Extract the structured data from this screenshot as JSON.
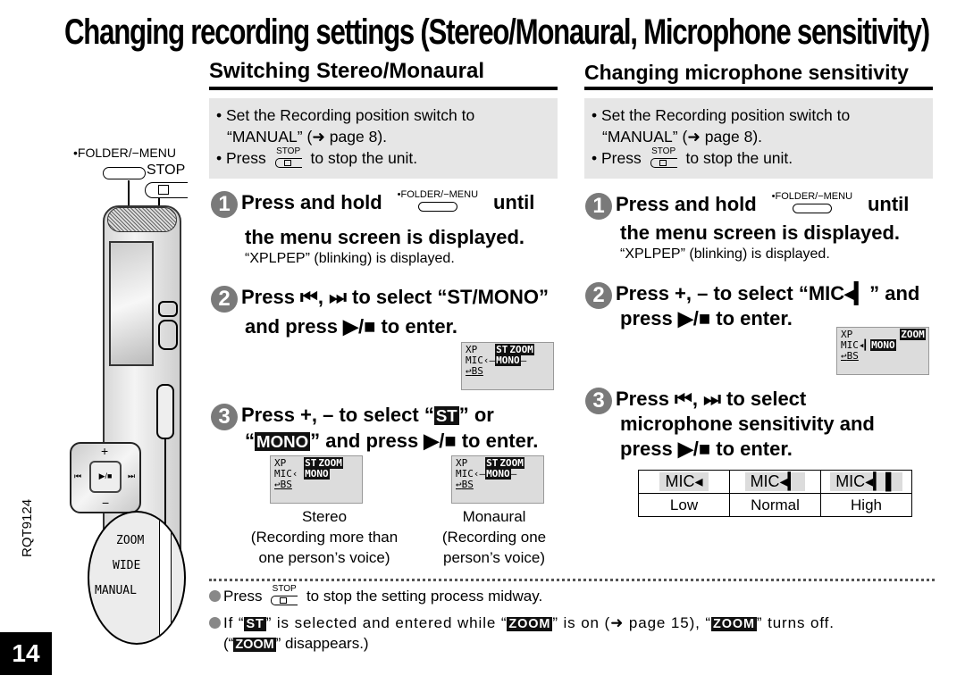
{
  "page": {
    "title": "Changing recording settings (Stereo/Monaural, Microphone sensitivity)",
    "page_number": "14",
    "doc_code": "RQT9124"
  },
  "device_illustration": {
    "folder_menu_label": "•FOLDER/−MENU",
    "stop_label": "STOP",
    "switch_labels": [
      "ZOOM",
      "WIDE",
      "MANUAL"
    ],
    "pad_labels": {
      "plus": "+",
      "minus": "−",
      "play_stop": "▶/■",
      "prev": "⏮",
      "next": "⏭"
    }
  },
  "left": {
    "section_title": "Switching Stereo/Monaural",
    "prereq": {
      "line1": "• Set the Recording position switch to",
      "line2": "“MANUAL” (➜ page 8).",
      "line3_pre": "• Press",
      "line3_post": "to stop the unit."
    },
    "step1": {
      "num": "1",
      "text_a": "Press and hold",
      "text_b": "until",
      "text_c": "the menu screen is displayed.",
      "sub": "“XPLPEP” (blinking) is displayed."
    },
    "step2": {
      "num": "2",
      "line1": "Press ⏮, ⏭ to select “ST/MONO”",
      "line2": "and press ▶/■ to enter.",
      "lcd": {
        "row1a": "XP",
        "row1b": "ST",
        "row1c": "ZOOM",
        "row2a": "MIC",
        "row2b": "MONO",
        "row3": "BS"
      }
    },
    "step3": {
      "num": "3",
      "line1_pre": "Press +, – to select “",
      "line1_inv": "ST",
      "line1_post": "” or",
      "line2_pre": "“",
      "line2_inv": "MONO",
      "line2_post": "” and press ▶/■ to enter.",
      "options": [
        {
          "label": "Stereo",
          "desc1": "(Recording more than",
          "desc2": "one person’s voice)"
        },
        {
          "label": "Monaural",
          "desc1": "(Recording one",
          "desc2": "person’s voice)"
        }
      ]
    }
  },
  "right": {
    "section_title": "Changing microphone sensitivity",
    "prereq": {
      "line1": "• Set the Recording position switch to",
      "line2": "“MANUAL” (➜ page 8).",
      "line3_pre": "• Press",
      "line3_post": "to stop the unit."
    },
    "step1": {
      "num": "1",
      "text_a": "Press and hold",
      "text_b": "until",
      "text_c": "the menu screen is displayed.",
      "sub": "“XPLPEP” (blinking) is displayed."
    },
    "step2": {
      "num": "2",
      "line1": "Press +, – to select “MIC◂▎” and",
      "line2": "press ▶/■ to enter.",
      "lcd": {
        "row1a": "XP",
        "row1c": "ZOOM",
        "row2a": "MIC",
        "row2b": "MONO",
        "row3": "BS"
      }
    },
    "step3": {
      "num": "3",
      "line1": "Press ⏮, ⏭ to select",
      "line2": "microphone sensitivity and",
      "line3": "press ▶/■ to enter."
    },
    "sensitivity_table": {
      "icons": [
        "MIC◂",
        "MIC◂▎",
        "MIC◂▎▌"
      ],
      "labels": [
        "Low",
        "Normal",
        "High"
      ]
    }
  },
  "notes": {
    "note1_pre": "Press",
    "note1_post": "to stop the setting process midway.",
    "note2_a": "If “",
    "note2_st": "ST",
    "note2_b": "” is selected and entered while “",
    "note2_zoom": "ZOOM",
    "note2_c": "” is on (➜ page 15), “",
    "note2_zoom2": "ZOOM",
    "note2_d": "” turns off.",
    "note3_a": "(“",
    "note3_zoom": "ZOOM",
    "note3_b": "” disappears.)"
  },
  "stop_key_label": "STOP"
}
